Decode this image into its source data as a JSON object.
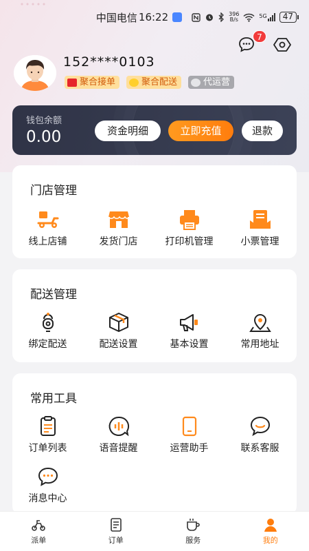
{
  "status_bar": {
    "carrier": "中国电信",
    "time": "16:22",
    "network_speed": "396\nB/s",
    "signal": "5G",
    "battery": "47"
  },
  "header": {
    "message_badge_count": "7",
    "phone": "152****0103",
    "tags": [
      {
        "label": "聚合接单",
        "icon": "order-tag-icon"
      },
      {
        "label": "聚合配送",
        "icon": "delivery-tag-icon"
      },
      {
        "label": "代运营",
        "icon": "star-tag-icon"
      }
    ]
  },
  "wallet": {
    "label": "钱包余额",
    "amount": "0.00",
    "details_button": "资金明细",
    "recharge_button": "立即充值",
    "refund_button": "退款"
  },
  "store_management": {
    "title": "门店管理",
    "items": [
      {
        "label": "线上店铺",
        "icon": "scooter-icon"
      },
      {
        "label": "发货门店",
        "icon": "storefront-icon"
      },
      {
        "label": "打印机管理",
        "icon": "printer-icon"
      },
      {
        "label": "小票管理",
        "icon": "receipt-box-icon"
      }
    ]
  },
  "delivery_management": {
    "title": "配送管理",
    "items": [
      {
        "label": "绑定配送",
        "icon": "courier-icon"
      },
      {
        "label": "配送设置",
        "icon": "package-icon"
      },
      {
        "label": "基本设置",
        "icon": "megaphone-icon"
      },
      {
        "label": "常用地址",
        "icon": "location-icon"
      }
    ]
  },
  "common_tools": {
    "title": "常用工具",
    "items": [
      {
        "label": "订单列表",
        "icon": "clipboard-icon"
      },
      {
        "label": "语音提醒",
        "icon": "voice-icon"
      },
      {
        "label": "运营助手",
        "icon": "tablet-icon"
      },
      {
        "label": "联系客服",
        "icon": "chat-service-icon"
      },
      {
        "label": "消息中心",
        "icon": "message-icon"
      }
    ]
  },
  "tabbar": {
    "active_color": "#ff7d0d",
    "tabs": [
      {
        "label": "派单",
        "icon": "rider-icon"
      },
      {
        "label": "订单",
        "icon": "order-icon"
      },
      {
        "label": "服务",
        "icon": "coffee-icon"
      },
      {
        "label": "我的",
        "icon": "user-icon",
        "active": true
      }
    ]
  }
}
